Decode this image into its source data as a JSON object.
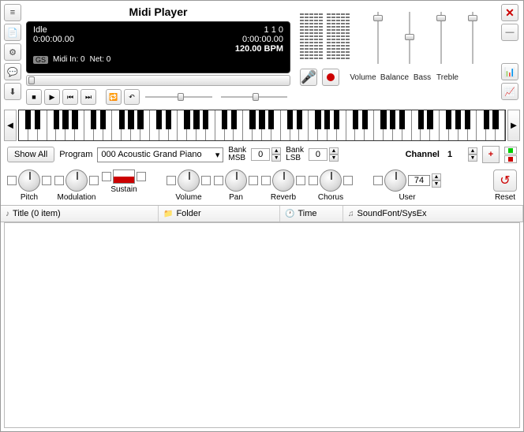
{
  "title": "Midi Player",
  "lcd": {
    "state": "Idle",
    "counters": "1   1   0",
    "time_left": "0:00:00.00",
    "time_right": "0:00:00.00",
    "bpm": "120.00 BPM",
    "gs": "GS",
    "midi_in": "Midi In: 0",
    "net": "Net: 0"
  },
  "mixer_labels": {
    "volume": "Volume",
    "balance": "Balance",
    "bass": "Bass",
    "treble": "Treble"
  },
  "program": {
    "show_all": "Show All",
    "label": "Program",
    "value": "000 Acoustic Grand Piano",
    "bank_msb_label": "Bank\nMSB",
    "bank_msb": "0",
    "bank_lsb_label": "Bank\nLSB",
    "bank_lsb": "0",
    "channel_label": "Channel",
    "channel": "1"
  },
  "knobs": {
    "pitch": "Pitch",
    "modulation": "Modulation",
    "sustain": "Sustain",
    "volume": "Volume",
    "pan": "Pan",
    "reverb": "Reverb",
    "chorus": "Chorus",
    "user": "User",
    "user_val": "74",
    "reset": "Reset"
  },
  "playlist": {
    "title": "Title (0 item)",
    "folder": "Folder",
    "time": "Time",
    "sf": "SoundFont/SysEx"
  }
}
